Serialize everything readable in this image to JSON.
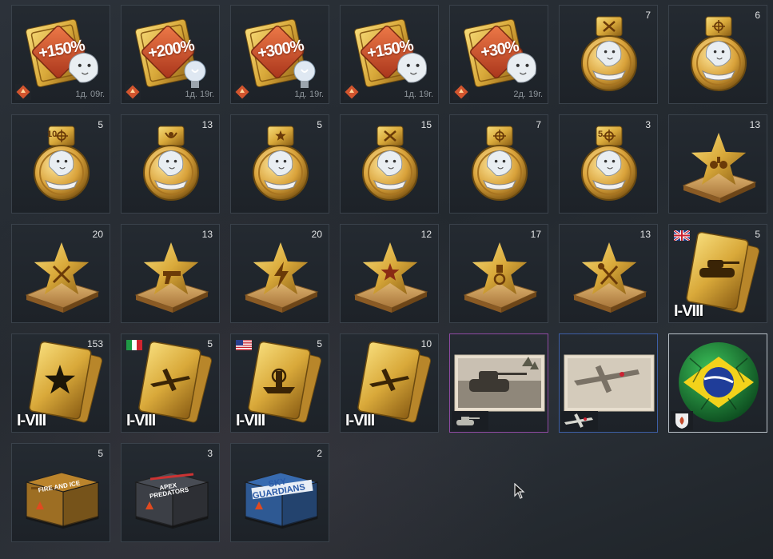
{
  "boosters": [
    {
      "label": "+150%",
      "timer": "1д. 09г.",
      "kind": "lion"
    },
    {
      "label": "+200%",
      "timer": "1д. 19г.",
      "kind": "bulb"
    },
    {
      "label": "+300%",
      "timer": "1д. 19г.",
      "kind": "bulb"
    },
    {
      "label": "+150%",
      "timer": "1д. 19г.",
      "kind": "lion"
    },
    {
      "label": "+30%",
      "timer": "2д. 19г.",
      "kind": "lion"
    }
  ],
  "medals": [
    {
      "count": "7",
      "emblem": "cross"
    },
    {
      "count": "6",
      "emblem": "target"
    },
    {
      "count": "5",
      "emblem": "target",
      "prefix": "10"
    },
    {
      "count": "13",
      "emblem": "wreath"
    },
    {
      "count": "5",
      "emblem": "star"
    },
    {
      "count": "15",
      "emblem": "cross"
    },
    {
      "count": "7",
      "emblem": "target"
    },
    {
      "count": "3",
      "emblem": "target",
      "prefix": "5"
    }
  ],
  "stars": [
    {
      "count": "13",
      "emblem": "bombs"
    },
    {
      "count": "20",
      "emblem": "swords"
    },
    {
      "count": "13",
      "emblem": "pistol"
    },
    {
      "count": "20",
      "emblem": "lightning"
    },
    {
      "count": "12",
      "emblem": "star"
    },
    {
      "count": "17",
      "emblem": "medal"
    },
    {
      "count": "13",
      "emblem": "wrench"
    }
  ],
  "cards": [
    {
      "count": "5",
      "rank": "I-VIII",
      "flag": "uk",
      "emblem": "tank"
    },
    {
      "count": "153",
      "rank": "I-VIII",
      "flag": "",
      "emblem": "star"
    },
    {
      "count": "5",
      "rank": "I-VIII",
      "flag": "italy",
      "emblem": "plane"
    },
    {
      "count": "5",
      "rank": "I-VIII",
      "flag": "usa",
      "emblem": "ship"
    },
    {
      "count": "10",
      "rank": "I-VIII",
      "flag": "",
      "emblem": "plane"
    }
  ],
  "specials": [
    {
      "kind": "tank-decal",
      "icon": "tank-icon"
    },
    {
      "kind": "plane-decal",
      "icon": "plane-icon"
    },
    {
      "kind": "brazil-ball",
      "icon": "shield-icon"
    }
  ],
  "crates": [
    {
      "count": "5",
      "title": "FIRE AND ICE",
      "color": "#c48a2c"
    },
    {
      "count": "3",
      "title": "APEX PREDATORS",
      "color": "#4b4f57"
    },
    {
      "count": "2",
      "title": "SKY GUARDIANS",
      "color": "#3a6fb8"
    }
  ],
  "colors": {
    "gold": "#d9a93a",
    "gold_dark": "#8a5d14",
    "booster_red": "#d2552e"
  }
}
